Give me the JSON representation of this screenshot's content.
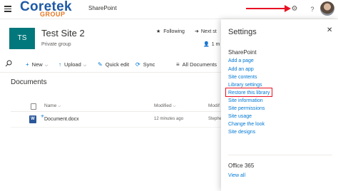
{
  "topbar": {
    "logo_main": "Coretek",
    "logo_sub": "GROUP",
    "app_name": "SharePoint",
    "help_label": "?"
  },
  "site": {
    "logo_initials": "TS",
    "title": "Test Site 2",
    "subtitle": "Private group",
    "following_label": "Following",
    "next_steps_label": "Next st",
    "members_label": "1 m"
  },
  "commandbar": {
    "new_label": "New",
    "upload_label": "Upload",
    "quick_edit_label": "Quick edit",
    "sync_label": "Sync",
    "view_label": "All Documents"
  },
  "library": {
    "heading": "Documents",
    "columns": {
      "name": "Name",
      "modified": "Modified",
      "modified_by": "Modif"
    },
    "rows": [
      {
        "name": "Document.docx",
        "modified": "12 minutes ago",
        "modified_by": "Stephe"
      }
    ]
  },
  "settings_panel": {
    "title": "Settings",
    "sharepoint_section": "SharePoint",
    "links": [
      "Add a page",
      "Add an app",
      "Site contents",
      "Library settings",
      "Restore this library",
      "Site information",
      "Site permissions",
      "Site usage",
      "Change the look",
      "Site designs"
    ],
    "office_section": "Office 365",
    "office_link": "View all"
  },
  "colors": {
    "accent": "#0078d4",
    "site_logo": "#03787c",
    "annotation": "#e81123",
    "word": "#2b579a"
  }
}
